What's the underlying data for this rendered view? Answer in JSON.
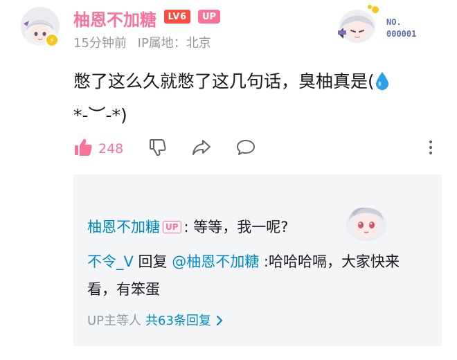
{
  "comment": {
    "author": {
      "name": "柚恩不加糖",
      "level": "LV6",
      "up_badge": "UP"
    },
    "time": "15分钟前",
    "ip_location": "IP属地：北京",
    "fan_card": {
      "label": "NO.",
      "number": "000001"
    },
    "text": "憋了这么久就憋了这几句话，臭柚真是(",
    "text_tail": "*-︶-*)",
    "actions": {
      "like_count": "248"
    }
  },
  "replies": {
    "items": [
      {
        "author": "柚恩不加糖",
        "up_badge": "UP",
        "text": ": 等等，我一呢?"
      },
      {
        "author": "不令_V",
        "reply_word": " 回复 ",
        "mention": "@柚恩不加糖",
        "text": " :哈哈哈嗝，大家快来看，有笨蛋"
      }
    ],
    "footer": {
      "who": "UP主等人",
      "total": "共63条回复"
    }
  },
  "colors": {
    "brand_pink": "#fb7299",
    "link_blue": "#008ac5",
    "level_red": "#fb4d3d",
    "muted_gray": "#9499a0",
    "reply_bg": "#f4f5f7"
  },
  "icons": {
    "like": "thumbs-up-icon",
    "dislike": "thumbs-down-icon",
    "share": "share-arrow-icon",
    "reply": "speech-bubble-icon",
    "more": "more-vertical-icon",
    "verified": "lightning-badge-icon",
    "emoji": "water-drop-icon"
  }
}
